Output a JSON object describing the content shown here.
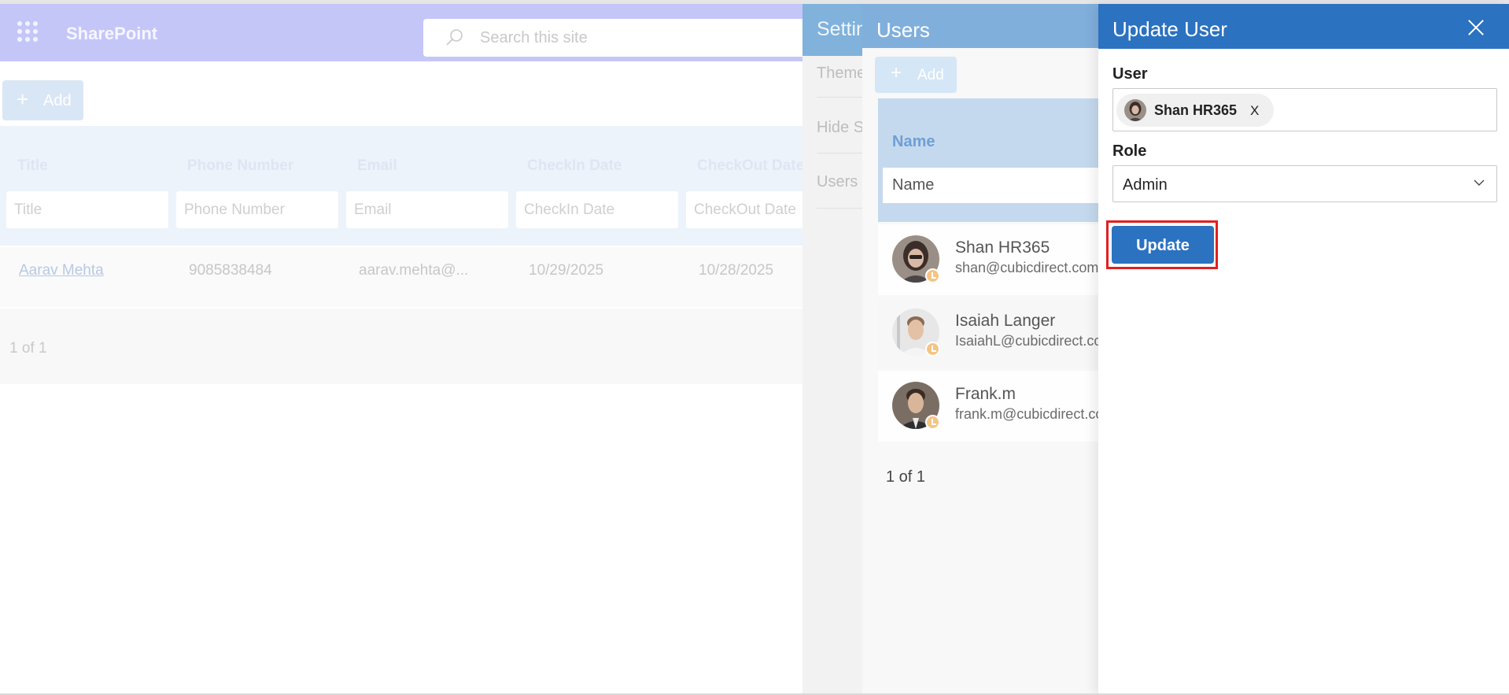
{
  "suitebar": {
    "app_name": "SharePoint",
    "search_placeholder": "Search this site"
  },
  "list": {
    "add_label": "Add",
    "columns": [
      "Title",
      "Phone Number",
      "Email",
      "CheckIn Date",
      "CheckOut Date"
    ],
    "filters": [
      "Title",
      "Phone Number",
      "Email",
      "CheckIn Date",
      "CheckOut Date"
    ],
    "rows": [
      [
        "Aarav Mehta",
        "9085838484",
        "aarav.mehta@...",
        "10/29/2025",
        "10/28/2025"
      ]
    ],
    "pager": "1 of 1"
  },
  "settings": {
    "title": "Settings",
    "items": [
      "Theme",
      "Hide S",
      "Users"
    ]
  },
  "users_panel": {
    "title": "Users",
    "add_label": "Add",
    "column_name": "Name",
    "filter_placeholder": "Name",
    "users": [
      {
        "name": "Shan HR365",
        "email": "shan@cubicdirect.com"
      },
      {
        "name": "Isaiah Langer",
        "email": "IsaiahL@cubicdirect.com"
      },
      {
        "name": "Frank.m",
        "email": "frank.m@cubicdirect.com"
      }
    ],
    "pager": "1 of 1"
  },
  "update_user": {
    "title": "Update User",
    "user_label": "User",
    "selected_user": "Shan HR365",
    "remove_label": "X",
    "role_label": "Role",
    "role_value": "Admin",
    "submit_label": "Update"
  },
  "colors": {
    "suitebar": "#c5c6f8",
    "panel_header": "#2b72c0",
    "highlight": "#e0201e"
  }
}
